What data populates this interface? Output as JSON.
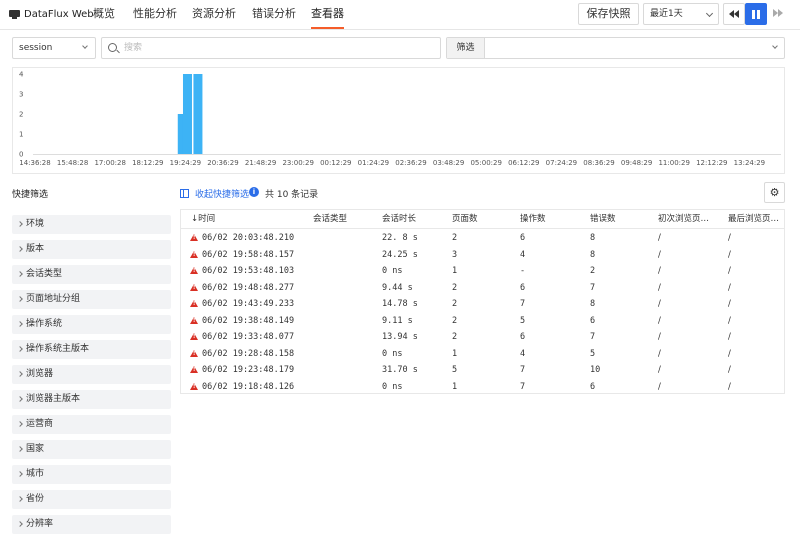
{
  "app": {
    "title": "DataFlux Web"
  },
  "nav": [
    {
      "label": "概览",
      "active": false
    },
    {
      "label": "性能分析",
      "active": false
    },
    {
      "label": "资源分析",
      "active": false
    },
    {
      "label": "错误分析",
      "active": false
    },
    {
      "label": "查看器",
      "active": true
    }
  ],
  "toolbar": {
    "snapshot_label": "保存快照",
    "time_range": "最近1天"
  },
  "filters": {
    "source": "session",
    "search_placeholder": "搜索",
    "filter_label": "筛选"
  },
  "chart_data": {
    "type": "bar",
    "x_tick_labels": [
      "14:36:28",
      "15:48:28",
      "17:00:28",
      "18:12:29",
      "19:24:29",
      "20:36:29",
      "21:48:29",
      "23:00:29",
      "00:12:29",
      "01:24:29",
      "02:36:29",
      "03:48:29",
      "05:00:29",
      "06:12:29",
      "07:24:29",
      "08:36:29",
      "09:48:29",
      "11:00:29",
      "12:12:29",
      "13:24:29"
    ],
    "y_ticks": [
      0,
      1,
      2,
      3,
      4
    ],
    "ylim": [
      0,
      4
    ],
    "bars": [
      {
        "bin": "19:18",
        "value": 2
      },
      {
        "bin": "19:28",
        "value": 4
      },
      {
        "bin": "19:48",
        "value": 4
      }
    ],
    "bar_color": "#3db3f5"
  },
  "quick_filter": {
    "title": "快捷筛选",
    "items": [
      "环境",
      "版本",
      "会话类型",
      "页面地址分组",
      "操作系统",
      "操作系统主版本",
      "浏览器",
      "浏览器主版本",
      "运营商",
      "国家",
      "城市",
      "省份",
      "分辨率"
    ]
  },
  "list": {
    "collapse_label": "收起快捷筛选",
    "count_label": "共 10 条记录"
  },
  "table": {
    "columns": [
      "↓时间",
      "会话类型",
      "会话时长",
      "页面数",
      "操作数",
      "错误数",
      "初次浏览页…",
      "最后浏览页…"
    ],
    "rows": [
      [
        "06/02 20:03:48.210",
        "",
        "22. 8 s",
        "2",
        "6",
        "8",
        "/",
        "/"
      ],
      [
        "06/02 19:58:48.157",
        "",
        "24.25 s",
        "3",
        "4",
        "8",
        "/",
        "/"
      ],
      [
        "06/02 19:53:48.103",
        "",
        "0 ns",
        "1",
        "-",
        "2",
        "/",
        "/"
      ],
      [
        "06/02 19:48:48.277",
        "",
        "9.44 s",
        "2",
        "6",
        "7",
        "/",
        "/"
      ],
      [
        "06/02 19:43:49.233",
        "",
        "14.78 s",
        "2",
        "7",
        "8",
        "/",
        "/"
      ],
      [
        "06/02 19:38:48.149",
        "",
        "9.11 s",
        "2",
        "5",
        "6",
        "/",
        "/"
      ],
      [
        "06/02 19:33:48.077",
        "",
        "13.94 s",
        "2",
        "6",
        "7",
        "/",
        "/"
      ],
      [
        "06/02 19:28:48.158",
        "",
        "0 ns",
        "1",
        "4",
        "5",
        "/",
        "/"
      ],
      [
        "06/02 19:23:48.179",
        "",
        "31.70 s",
        "5",
        "7",
        "10",
        "/",
        "/"
      ],
      [
        "06/02 19:18:48.126",
        "",
        "0 ns",
        "1",
        "7",
        "6",
        "/",
        "/"
      ]
    ]
  }
}
